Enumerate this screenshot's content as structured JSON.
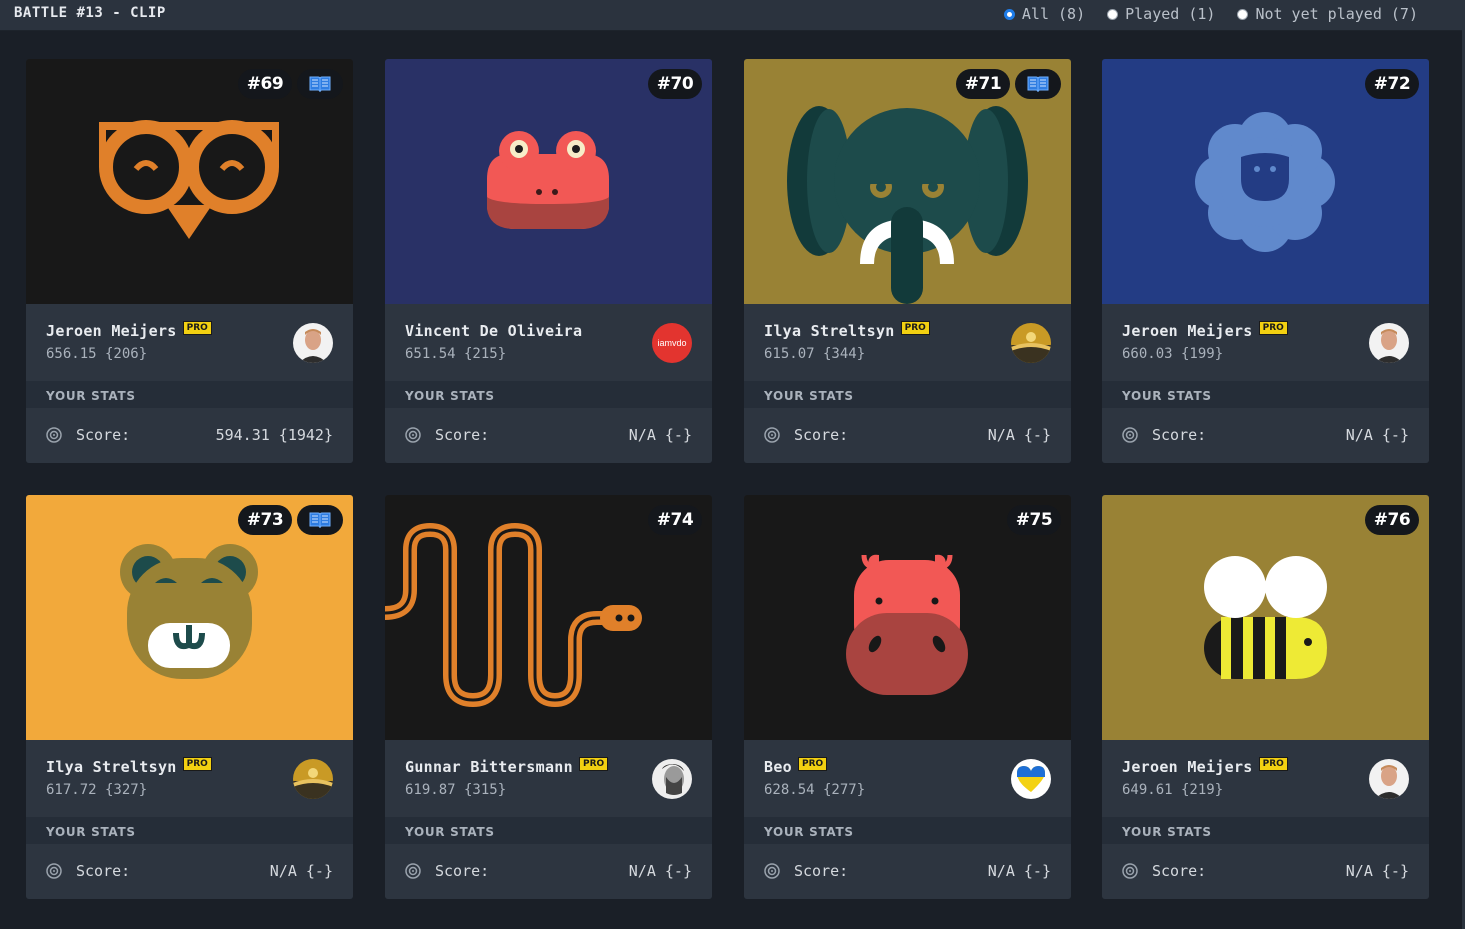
{
  "header": {
    "title": "BATTLE #13 - CLIP",
    "filters": [
      {
        "label": "All (8)",
        "checked": true
      },
      {
        "label": "Played (1)",
        "checked": false
      },
      {
        "label": "Not yet played (7)",
        "checked": false
      }
    ]
  },
  "cards": [
    {
      "number": "#69",
      "author": "Jeroen Meijers",
      "pro": "PRO",
      "author_score": "656.15 {206}",
      "stats_label": "YOUR STATS",
      "score_label": "Score:",
      "score_value": "594.31 {1942}"
    },
    {
      "number": "#70",
      "author": "Vincent De Oliveira",
      "author_score": "651.54 {215}",
      "stats_label": "YOUR STATS",
      "score_label": "Score:",
      "score_value": "N/A {-}",
      "avatar_text": "iamvdo"
    },
    {
      "number": "#71",
      "author": "Ilya Streltsyn",
      "pro": "PRO",
      "author_score": "615.07 {344}",
      "stats_label": "YOUR STATS",
      "score_label": "Score:",
      "score_value": "N/A {-}"
    },
    {
      "number": "#72",
      "author": "Jeroen Meijers",
      "pro": "PRO",
      "author_score": "660.03 {199}",
      "stats_label": "YOUR STATS",
      "score_label": "Score:",
      "score_value": "N/A {-}"
    },
    {
      "number": "#73",
      "author": "Ilya Streltsyn",
      "pro": "PRO",
      "author_score": "617.72 {327}",
      "stats_label": "YOUR STATS",
      "score_label": "Score:",
      "score_value": "N/A {-}"
    },
    {
      "number": "#74",
      "author": "Gunnar Bittersmann",
      "pro": "PRO",
      "author_score": "619.87 {315}",
      "stats_label": "YOUR STATS",
      "score_label": "Score:",
      "score_value": "N/A {-}"
    },
    {
      "number": "#75",
      "author": "Beo",
      "pro": "PRO",
      "author_score": "628.54 {277}",
      "stats_label": "YOUR STATS",
      "score_label": "Score:",
      "score_value": "N/A {-}"
    },
    {
      "number": "#76",
      "author": "Jeroen Meijers",
      "pro": "PRO",
      "author_score": "649.61 {219}",
      "stats_label": "YOUR STATS",
      "score_label": "Score:",
      "score_value": "N/A {-}"
    }
  ],
  "colors": {
    "page_bg": "#1a1f27",
    "card_bg": "#252d38",
    "panel_bg": "#2d3540",
    "pro_badge": "#f2d011",
    "radio_accent": "#1e7ce8"
  },
  "icons": {
    "book_badge": "book-open-icon",
    "score": "target-icon"
  }
}
